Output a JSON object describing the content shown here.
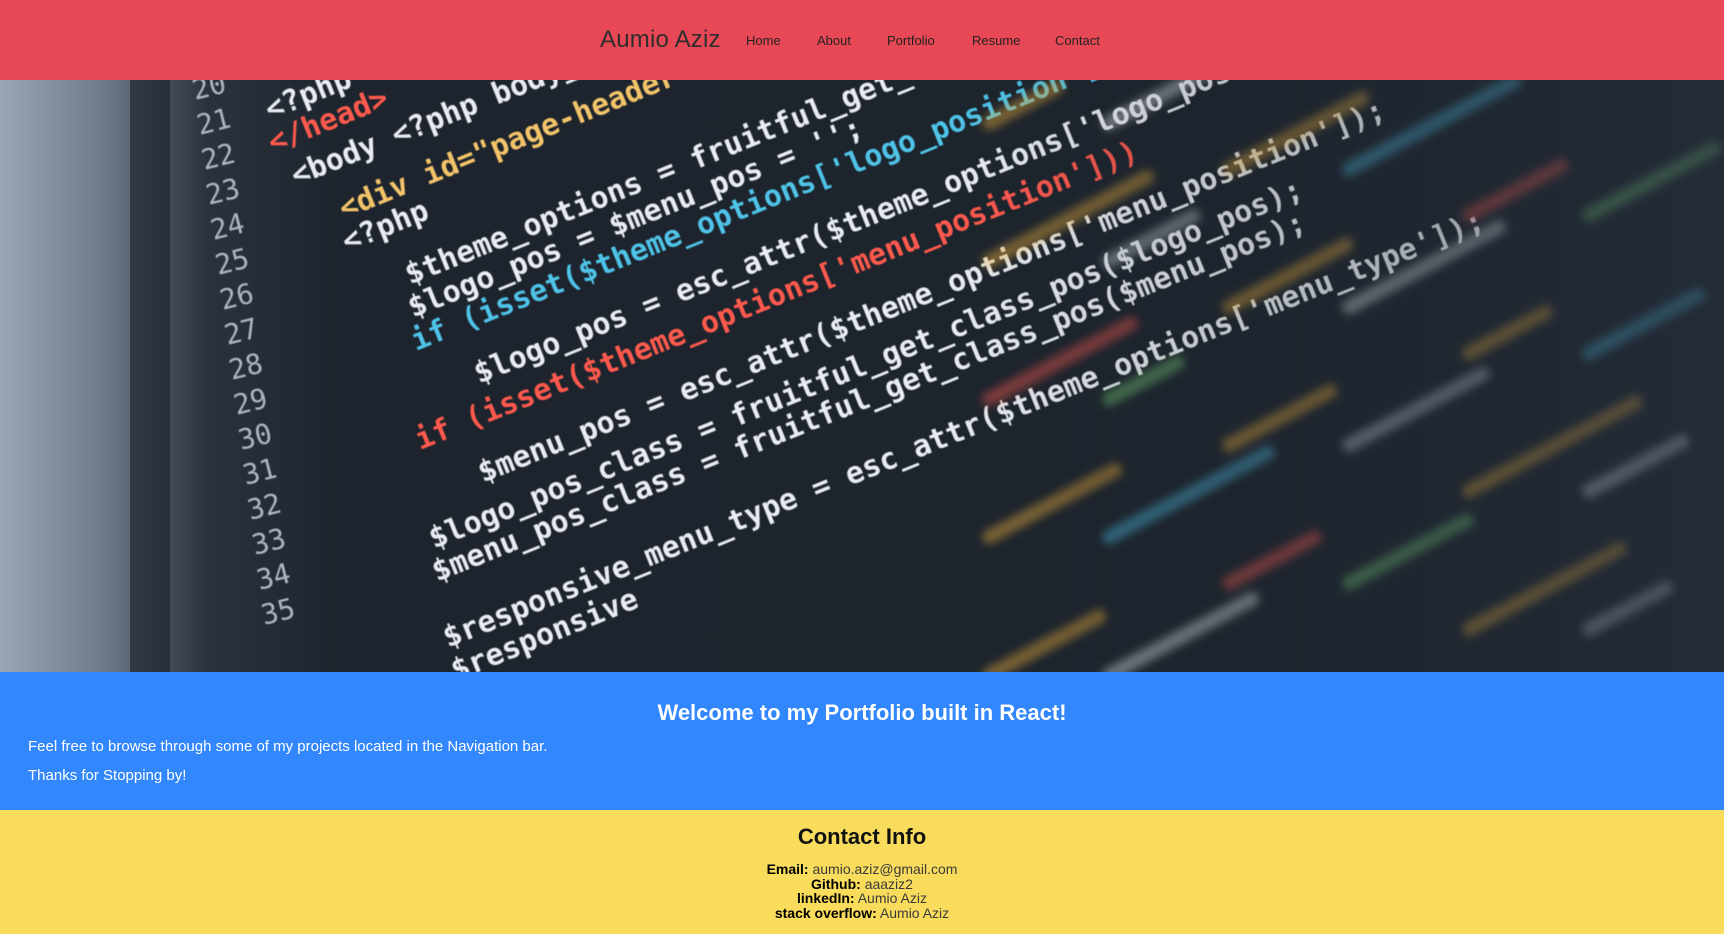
{
  "colors": {
    "nav_bg": "#e84855",
    "welcome_bg": "#3287fd",
    "contact_bg": "#f9dc5c"
  },
  "nav": {
    "brand": "Aumio Aziz",
    "links": [
      "Home",
      "About",
      "Portfolio",
      "Resume",
      "Contact"
    ]
  },
  "hero": {
    "image": "code-editor-photo",
    "code_lines": [
      "<?php wp_head(); ?>",
      "</head>",
      "<body <?php body_class(); ?>",
      "<div id=\"page-header\" class=",
      "<?php",
      "$theme_options = fruitful_get_theme_options();",
      "$logo_pos = $menu_pos = '';",
      "if (isset($theme_options['logo_position']))",
      "$logo_pos = esc_attr($theme_options['logo_position']);",
      "",
      "if (isset($theme_options['menu_position']))",
      "$menu_pos = esc_attr($theme_options['menu_position']);",
      "",
      "$logo_pos_class = fruitful_get_class_pos($logo_pos);",
      "$menu_pos_class = fruitful_get_class_pos($menu_pos);",
      "",
      "$responsive_menu_type = esc_attr($theme_options['menu_type']);",
      "$responsive"
    ],
    "line_numbers": [
      "20",
      "21",
      "22",
      "23",
      "24",
      "25",
      "26",
      "27",
      "28",
      "29",
      "30",
      "31",
      "32",
      "33",
      "34",
      "35"
    ]
  },
  "welcome": {
    "title": "Welcome to my Portfolio built in React!",
    "line1": "Feel free to browse through some of my projects located in the Navigation bar.",
    "line2": "Thanks for Stopping by!"
  },
  "contact": {
    "title": "Contact Info",
    "rows": [
      {
        "label": "Email:",
        "value": "aumio.aziz@gmail.com"
      },
      {
        "label": "Github:",
        "value": "aaaziz2"
      },
      {
        "label": "linkedIn:",
        "value": "Aumio Aziz"
      },
      {
        "label": "stack overflow:",
        "value": "Aumio Aziz"
      }
    ]
  }
}
